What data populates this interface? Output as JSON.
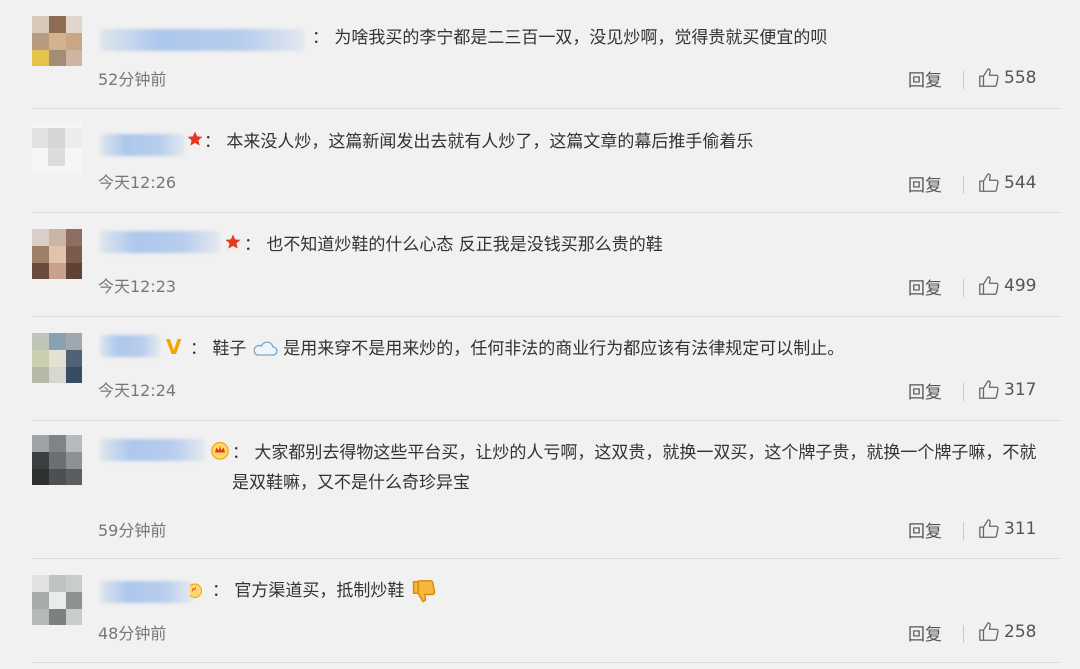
{
  "comments": [
    {
      "separator": "：",
      "text": "为啥我买的李宁都是二三百一双，没见炒啊，觉得贵就买便宜的呗",
      "time": "52分钟前",
      "reply_label": "回复",
      "likes": "558"
    },
    {
      "separator": "：",
      "text": "本来没人炒，这篇新闻发出去就有人炒了，这篇文章的幕后推手偷着乐",
      "time": "今天12:26",
      "reply_label": "回复",
      "likes": "544"
    },
    {
      "separator": "：",
      "text": "也不知道炒鞋的什么心态 反正我是没钱买那么贵的鞋",
      "time": "今天12:23",
      "reply_label": "回复",
      "likes": "499"
    },
    {
      "separator": "：",
      "text_before_emoji": "鞋子",
      "text_after_emoji": "是用来穿不是用来炒的，任何非法的商业行为都应该有法律规定可以制止。",
      "time": "今天12:24",
      "reply_label": "回复",
      "likes": "317"
    },
    {
      "separator": "：",
      "text": "大家都别去得物这些平台买，让炒的人亏啊，这双贵，就换一双买，这个牌子贵，就换一个牌子嘛，不就是双鞋嘛，又不是什么奇珍异宝",
      "time": "59分钟前",
      "reply_label": "回复",
      "likes": "311"
    },
    {
      "separator": "：",
      "text": "官方渠道买，抵制炒鞋",
      "time": "48分钟前",
      "reply_label": "回复",
      "likes": "258"
    }
  ],
  "icons": {
    "like": "thumbs-up-outline-icon",
    "verified": "orange-v-badge",
    "star": "red-star-badge",
    "crown": "crown-badge",
    "cloud_emoji": "cloud-emoji",
    "thumbs_down_emoji": "thumbs-down-emoji"
  },
  "colors": {
    "background": "#f1f1f1",
    "text": "#333333",
    "meta": "#777777",
    "star": "#e8371f",
    "v_badge": "#f5a300"
  }
}
